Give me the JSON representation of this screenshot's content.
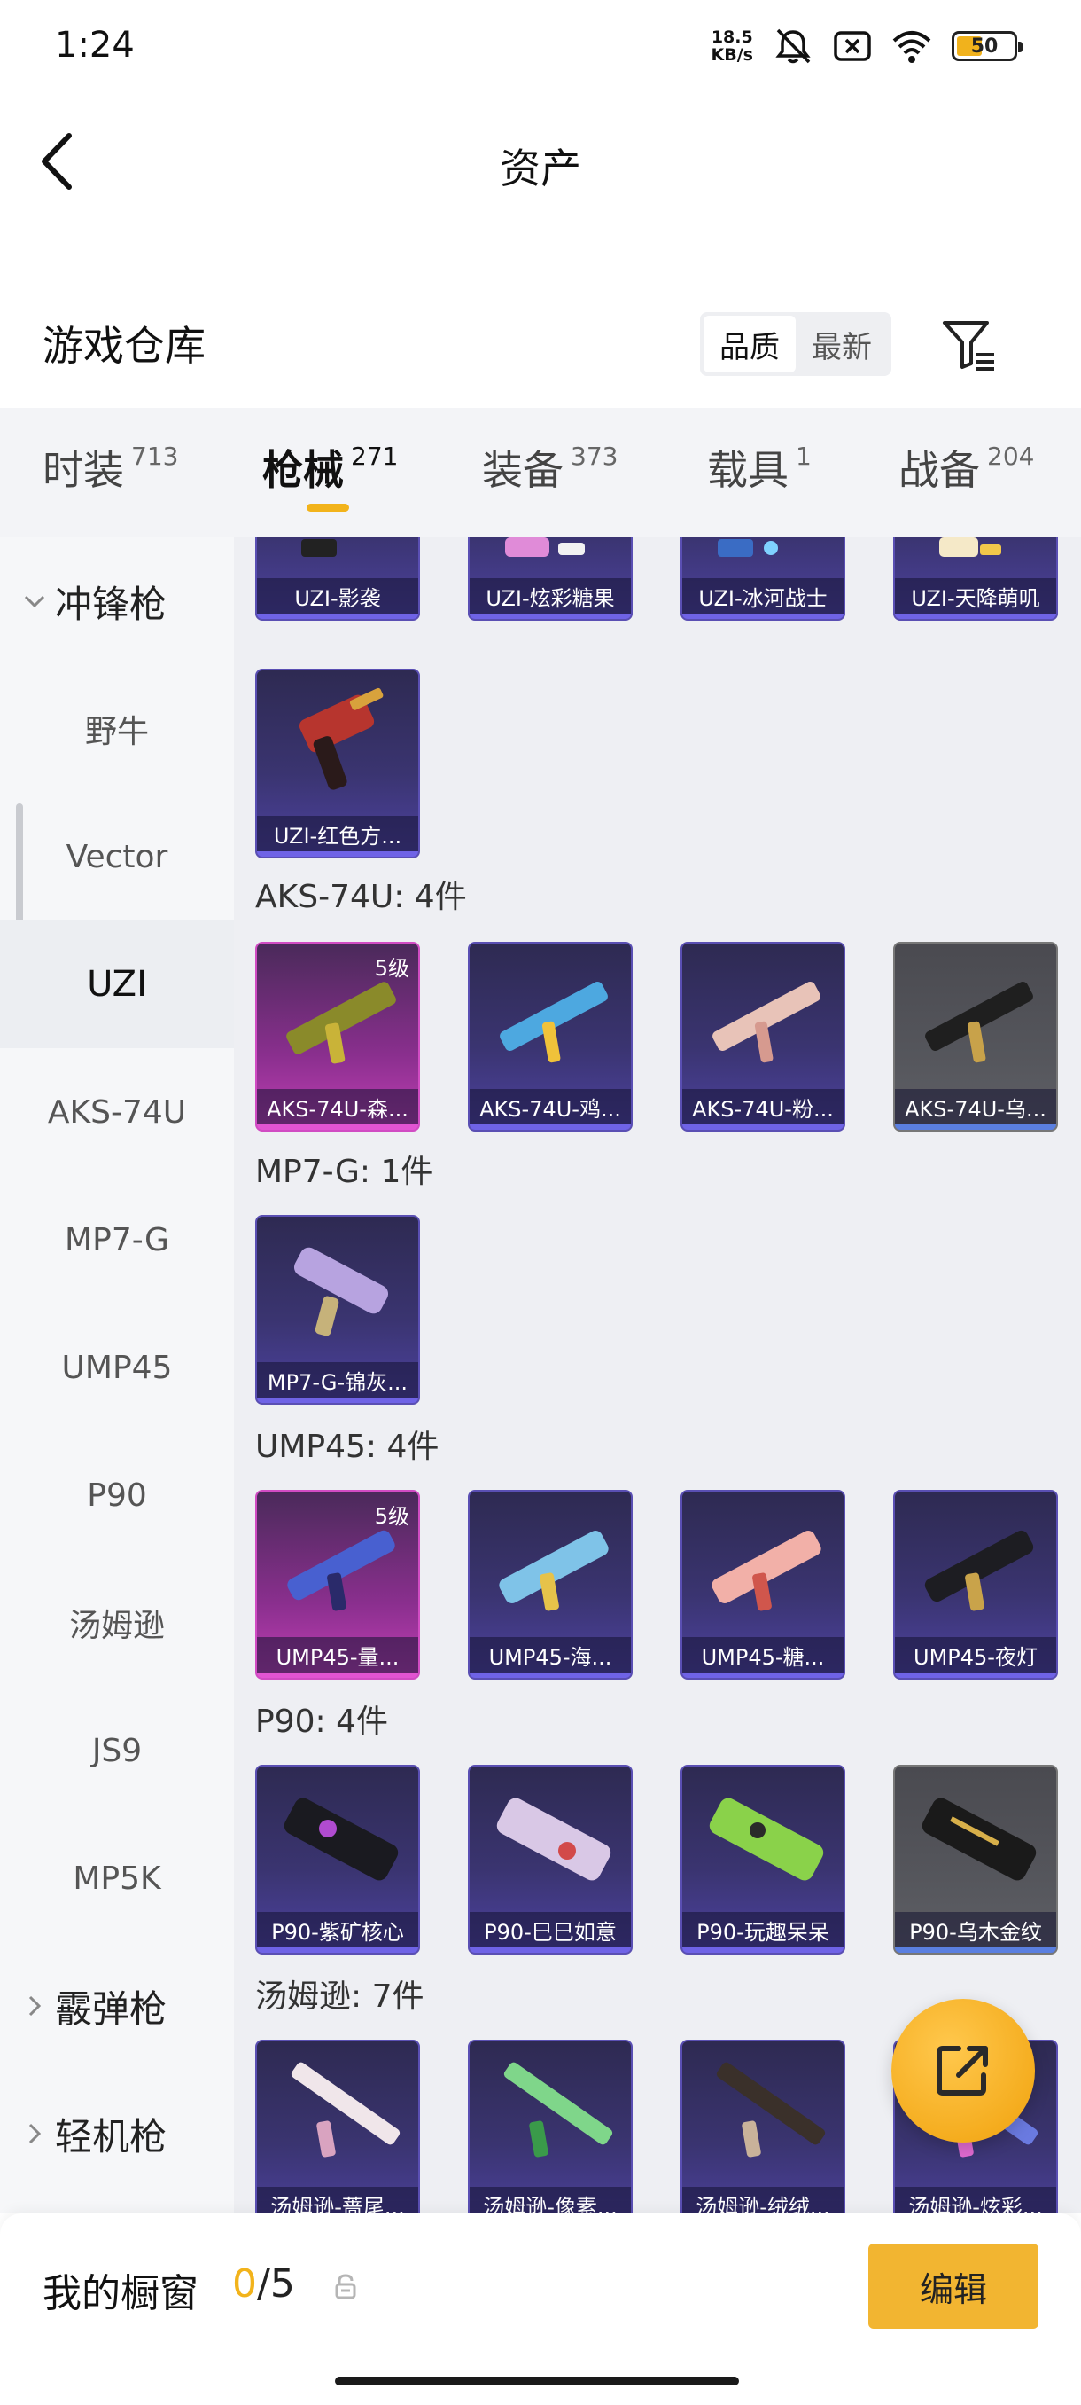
{
  "status_bar": {
    "time": "1:24",
    "net_speed_value": "18.5",
    "net_speed_unit": "KB/s",
    "battery_level": "50",
    "battery_fraction": 0.5
  },
  "header": {
    "title": "资产"
  },
  "warehouse": {
    "title": "游戏仓库",
    "sort_options": [
      "品质",
      "最新"
    ],
    "active_sort": "品质"
  },
  "tabs": [
    {
      "label": "时装",
      "count": "713"
    },
    {
      "label": "枪械",
      "count": "271",
      "active": true
    },
    {
      "label": "装备",
      "count": "373"
    },
    {
      "label": "载具",
      "count": "1"
    },
    {
      "label": "战备",
      "count": "204"
    }
  ],
  "sidebar": {
    "group_smg": "冲锋枪",
    "items": [
      "野牛",
      "Vector",
      "UZI",
      "AKS-74U",
      "MP7-G",
      "UMP45",
      "P90",
      "汤姆逊",
      "JS9",
      "MP5K"
    ],
    "active_item": "UZI",
    "group_shotgun": "霰弹枪",
    "group_lmg": "轻机枪"
  },
  "sections": {
    "uzi_top": [
      "UZI-影袭",
      "UZI-炫彩糖果",
      "UZI-冰河战士",
      "UZI-天降萌叽"
    ],
    "uzi_more": [
      "UZI-红色方..."
    ],
    "aks": {
      "title": "AKS-74U: 4件",
      "items": [
        "AKS-74U-森...",
        "AKS-74U-鸡...",
        "AKS-74U-粉...",
        "AKS-74U-乌..."
      ],
      "level": "5级"
    },
    "mp7": {
      "title": "MP7-G: 1件",
      "items": [
        "MP7-G-锦灰..."
      ]
    },
    "ump": {
      "title": "UMP45: 4件",
      "items": [
        "UMP45-量...",
        "UMP45-海...",
        "UMP45-糖...",
        "UMP45-夜灯"
      ],
      "level": "5级"
    },
    "p90": {
      "title": "P90: 4件",
      "items": [
        "P90-紫矿核心",
        "P90-巳巳如意",
        "P90-玩趣呆呆",
        "P90-乌木金纹"
      ]
    },
    "thompson": {
      "title": "汤姆逊: 7件",
      "items": [
        "汤姆逊-蔷尾...",
        "汤姆逊-像素...",
        "汤姆逊-绒绒...",
        "汤姆逊-炫彩..."
      ]
    }
  },
  "bottom": {
    "showcase_title": "我的橱窗",
    "showcase_current": "0",
    "showcase_total": "/5",
    "edit_label": "编辑"
  },
  "colors": {
    "accent": "#f2b31b",
    "card_purple": "#3a3470",
    "card_rare": "#c23fb5"
  }
}
